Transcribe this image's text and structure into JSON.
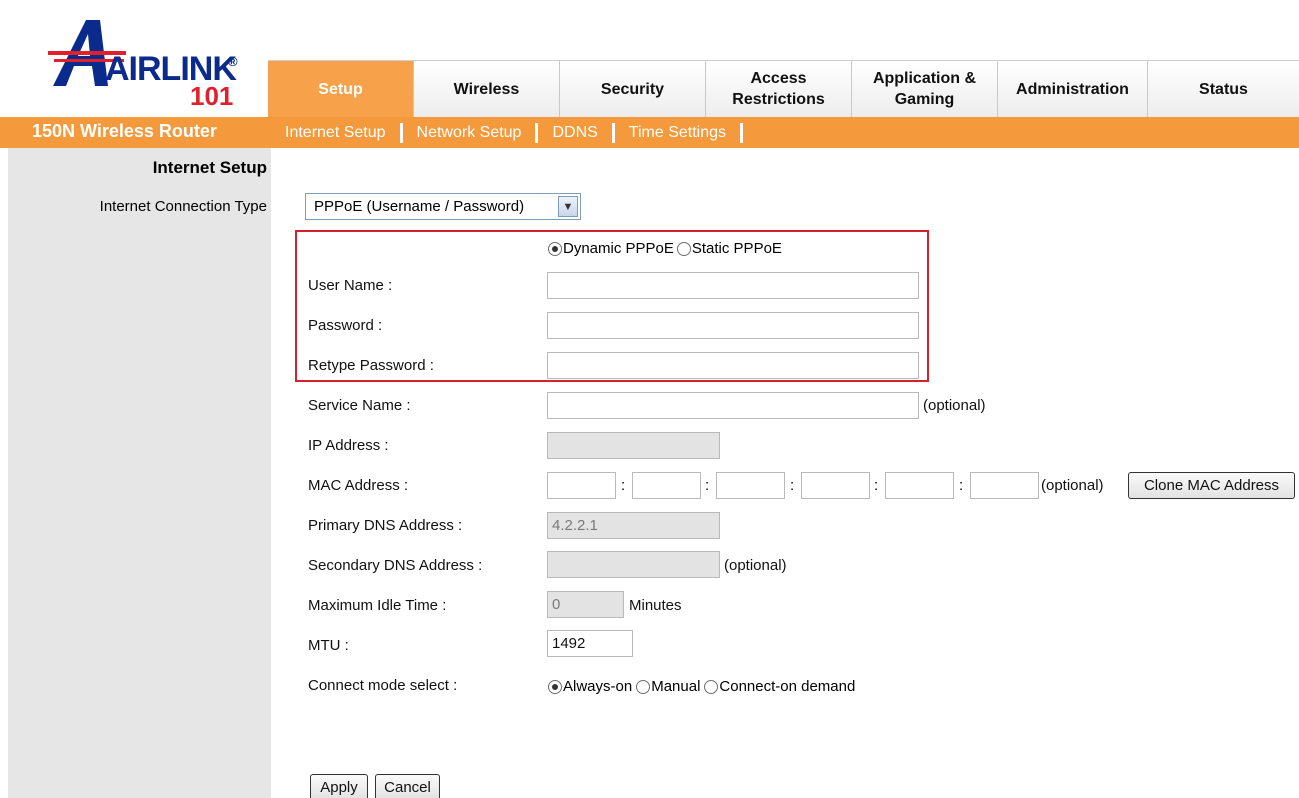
{
  "logo": {
    "brand": "AIRLINK",
    "reg": "®",
    "number": "101"
  },
  "nav": {
    "tabs": [
      {
        "label": "Setup",
        "active": true
      },
      {
        "label": "Wireless"
      },
      {
        "label": "Security"
      },
      {
        "label": "Access Restrictions"
      },
      {
        "label": "Application & Gaming"
      },
      {
        "label": "Administration"
      },
      {
        "label": "Status"
      }
    ],
    "active_color": "#f7a14a"
  },
  "subbar": {
    "product": "150N Wireless Router",
    "items": [
      "Internet Setup",
      "Network Setup",
      "DDNS",
      "Time Settings"
    ],
    "color": "#f49a3c"
  },
  "sidebar": {
    "section_title": "Internet Setup",
    "connection_type_label": "Internet Connection Type"
  },
  "form": {
    "connection_type": "PPPoE (Username / Password)",
    "pppoe_mode": {
      "options": [
        "Dynamic PPPoE",
        "Static PPPoE"
      ],
      "selected": "Dynamic PPPoE"
    },
    "user_name_label": "User Name :",
    "user_name": "",
    "password_label": "Password :",
    "password": "",
    "retype_label": "Retype Password :",
    "retype": "",
    "service_name_label": "Service Name :",
    "service_name": "",
    "optional": "(optional)",
    "ip_label": "IP Address :",
    "ip_value": "",
    "mac_label": "MAC Address :",
    "mac_values": [
      "",
      "",
      "",
      "",
      "",
      ""
    ],
    "mac_separator": ":",
    "clone_mac_button": "Clone MAC Address",
    "primary_dns_label": "Primary DNS Address :",
    "primary_dns": "4.2.2.1",
    "secondary_dns_label": "Secondary DNS Address :",
    "secondary_dns": "",
    "idle_label": "Maximum Idle Time :",
    "idle_value": "0",
    "idle_unit": "Minutes",
    "mtu_label": "MTU :",
    "mtu_value": "1492",
    "connect_mode_label": "Connect mode select :",
    "connect_mode": {
      "options": [
        "Always-on",
        "Manual",
        "Connect-on demand"
      ],
      "selected": "Always-on"
    },
    "apply_button": "Apply",
    "cancel_button": "Cancel"
  },
  "highlight_color": "#d6202c"
}
